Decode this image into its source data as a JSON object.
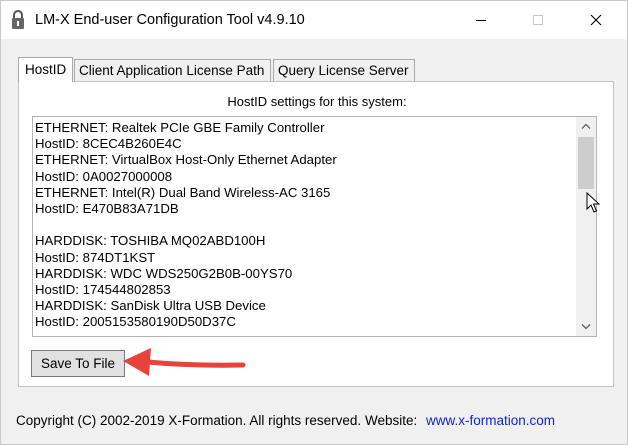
{
  "window": {
    "title": "LM-X End-user Configuration Tool v4.9.10"
  },
  "tabs": [
    {
      "label": "HostID",
      "active": true
    },
    {
      "label": "Client Application License Path",
      "active": false
    },
    {
      "label": "Query License Server",
      "active": false
    }
  ],
  "panel": {
    "heading": "HostID settings for this system:",
    "lines": [
      "ETHERNET: Realtek PCIe GBE Family Controller",
      "HostID: 8CEC4B260E4C",
      "ETHERNET: VirtualBox Host-Only Ethernet Adapter",
      "HostID: 0A0027000008",
      "ETHERNET: Intel(R) Dual Band Wireless-AC 3165",
      "HostID: E470B83A71DB",
      "",
      "HARDDISK: TOSHIBA MQ02ABD100H",
      "HostID: 874DT1KST",
      "HARDDISK: WDC WDS250G2B0B-00YS70",
      "HostID: 174544802853",
      "HARDDISK: SanDisk Ultra USB Device",
      "HostID: 2005153580190D50D37C"
    ],
    "save_label": "Save To File"
  },
  "footer": {
    "copyright": "Copyright (C) 2002-2019 X-Formation. All rights reserved.",
    "website_label": "Website:",
    "website_url": "www.x-formation.com"
  },
  "colors": {
    "link": "#0f1fd6",
    "annotation_arrow": "#e8423c"
  },
  "icons": {
    "app": "padlock-icon",
    "minimize": "minimize-icon",
    "maximize": "maximize-icon",
    "close": "close-icon"
  }
}
